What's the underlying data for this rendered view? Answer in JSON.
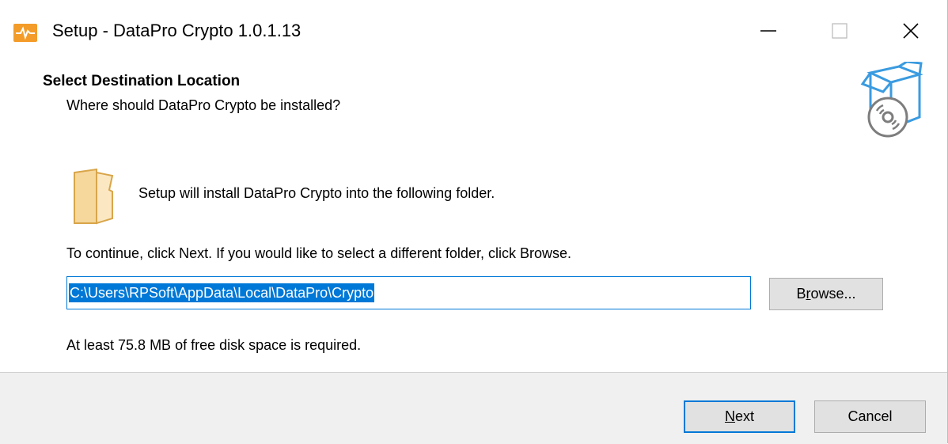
{
  "window": {
    "title": "Setup - DataPro Crypto 1.0.1.13",
    "controls": {
      "minimize": "—",
      "maximize": "☐",
      "close": "✕"
    }
  },
  "header": {
    "title": "Select Destination Location",
    "subtitle": "Where should DataPro Crypto be installed?"
  },
  "content": {
    "setup_text": "Setup will install DataPro Crypto into the following folder.",
    "continue_text": "To continue, click Next. If you would like to select a different folder, click Browse.",
    "path_value": "C:\\Users\\RPSoft\\AppData\\Local\\DataPro\\Crypto",
    "browse_label_prefix": "B",
    "browse_label_underlined": "r",
    "browse_label_suffix": "owse...",
    "disk_space_text": "At least 75.8 MB of free disk space is required."
  },
  "footer": {
    "next_label_underlined": "N",
    "next_label_suffix": "ext",
    "cancel_label": "Cancel"
  },
  "colors": {
    "accent": "#0078d7",
    "app_icon": "#f39c2a",
    "folder": "#f6d79c",
    "box_icon": "#3a9be0"
  }
}
